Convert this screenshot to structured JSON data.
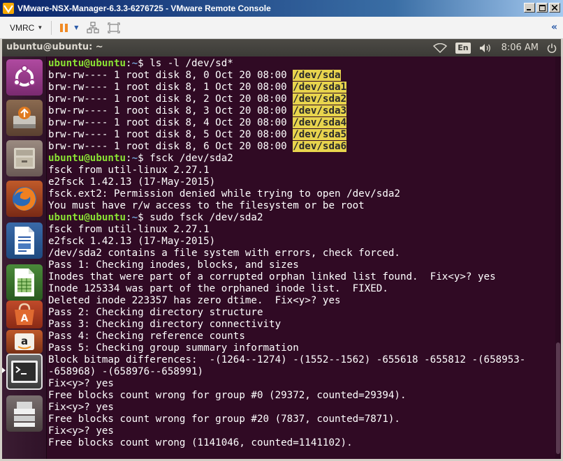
{
  "window": {
    "title": "VMware-NSX-Manager-6.3.3-6276725 - VMware Remote Console"
  },
  "toolbar": {
    "vmrc_label": "VMRC",
    "collapse_glyph": "«"
  },
  "panel": {
    "title": "ubuntu@ubuntu: ~",
    "keyboard_layout": "En",
    "clock": "8:06 AM"
  },
  "launcher": {
    "items": [
      {
        "name": "ubuntu-dash-icon"
      },
      {
        "name": "software-updater-icon"
      },
      {
        "name": "files-icon"
      },
      {
        "name": "firefox-icon"
      },
      {
        "name": "libreoffice-writer-icon"
      },
      {
        "name": "libreoffice-calc-icon"
      },
      {
        "name": "software-center-icon"
      },
      {
        "name": "amazon-icon"
      },
      {
        "name": "terminal-icon"
      },
      {
        "name": "drive-icon"
      }
    ]
  },
  "terminal": {
    "prompt": {
      "user": "ubuntu@ubuntu",
      "path": "~",
      "symbol": "$"
    },
    "lines": [
      {
        "type": "prompt",
        "cmd": " ls -l /dev/sd*"
      },
      {
        "type": "ls",
        "text": "brw-rw---- 1 root disk 8, 0 Oct 20 08:00 ",
        "dev": "/dev/sda"
      },
      {
        "type": "ls",
        "text": "brw-rw---- 1 root disk 8, 1 Oct 20 08:00 ",
        "dev": "/dev/sda1"
      },
      {
        "type": "ls",
        "text": "brw-rw---- 1 root disk 8, 2 Oct 20 08:00 ",
        "dev": "/dev/sda2"
      },
      {
        "type": "ls",
        "text": "brw-rw---- 1 root disk 8, 3 Oct 20 08:00 ",
        "dev": "/dev/sda3"
      },
      {
        "type": "ls",
        "text": "brw-rw---- 1 root disk 8, 4 Oct 20 08:00 ",
        "dev": "/dev/sda4"
      },
      {
        "type": "ls",
        "text": "brw-rw---- 1 root disk 8, 5 Oct 20 08:00 ",
        "dev": "/dev/sda5"
      },
      {
        "type": "ls",
        "text": "brw-rw---- 1 root disk 8, 6 Oct 20 08:00 ",
        "dev": "/dev/sda6"
      },
      {
        "type": "prompt",
        "cmd": " fsck /dev/sda2"
      },
      {
        "type": "text",
        "text": "fsck from util-linux 2.27.1"
      },
      {
        "type": "text",
        "text": "e2fsck 1.42.13 (17-May-2015)"
      },
      {
        "type": "text",
        "text": "fsck.ext2: Permission denied while trying to open /dev/sda2"
      },
      {
        "type": "text",
        "text": "You must have r/w access to the filesystem or be root"
      },
      {
        "type": "prompt",
        "cmd": " sudo fsck /dev/sda2"
      },
      {
        "type": "text",
        "text": "fsck from util-linux 2.27.1"
      },
      {
        "type": "text",
        "text": "e2fsck 1.42.13 (17-May-2015)"
      },
      {
        "type": "text",
        "text": "/dev/sda2 contains a file system with errors, check forced."
      },
      {
        "type": "text",
        "text": "Pass 1: Checking inodes, blocks, and sizes"
      },
      {
        "type": "text",
        "text": "Inodes that were part of a corrupted orphan linked list found.  Fix<y>? yes"
      },
      {
        "type": "text",
        "text": "Inode 125334 was part of the orphaned inode list.  FIXED."
      },
      {
        "type": "text",
        "text": "Deleted inode 223357 has zero dtime.  Fix<y>? yes"
      },
      {
        "type": "text",
        "text": "Pass 2: Checking directory structure"
      },
      {
        "type": "text",
        "text": "Pass 3: Checking directory connectivity"
      },
      {
        "type": "text",
        "text": "Pass 4: Checking reference counts"
      },
      {
        "type": "text",
        "text": "Pass 5: Checking group summary information"
      },
      {
        "type": "text",
        "text": "Block bitmap differences:  -(1264--1274) -(1552--1562) -655618 -655812 -(658953-"
      },
      {
        "type": "text",
        "text": "-658968) -(658976--658991)"
      },
      {
        "type": "text",
        "text": "Fix<y>? yes"
      },
      {
        "type": "text",
        "text": "Free blocks count wrong for group #0 (29372, counted=29394)."
      },
      {
        "type": "text",
        "text": "Fix<y>? yes"
      },
      {
        "type": "text",
        "text": "Free blocks count wrong for group #20 (7837, counted=7871)."
      },
      {
        "type": "text",
        "text": "Fix<y>? yes"
      },
      {
        "type": "text",
        "text": "Free blocks count wrong (1141046, counted=1141102)."
      }
    ]
  }
}
